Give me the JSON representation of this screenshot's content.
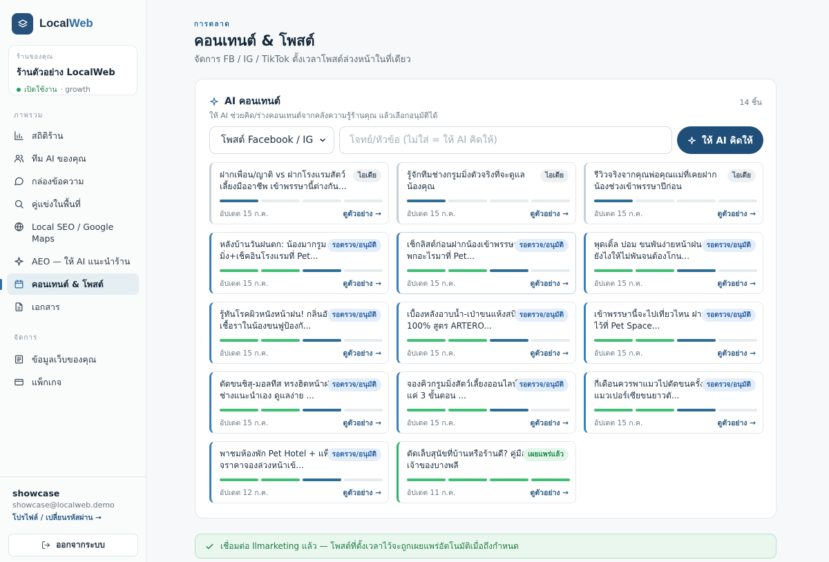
{
  "brand": {
    "name_prefix": "Local",
    "name_suffix": "Web"
  },
  "shop": {
    "kicker": "ร้านของคุณ",
    "name": "ร้านตัวอย่าง LocalWeb",
    "status": "เปิดใช้งาน",
    "plan": "· growth"
  },
  "nav": {
    "section_overview": "ภาพรวม",
    "items": [
      {
        "label": "สถิติร้าน",
        "icon": "chart-icon"
      },
      {
        "label": "ทีม AI ของคุณ",
        "icon": "users-icon"
      },
      {
        "label": "กล่องข้อความ",
        "icon": "message-icon"
      },
      {
        "label": "คู่แข่งในพื้นที่",
        "icon": "search-icon"
      },
      {
        "label": "Local SEO / Google Maps",
        "icon": "globe-icon"
      },
      {
        "label": "AEO — ให้ AI แนะนำร้าน",
        "icon": "sparkle-icon"
      },
      {
        "label": "คอนเทนต์ & โพสต์",
        "icon": "calendar-icon",
        "active": true
      },
      {
        "label": "เอกสาร",
        "icon": "document-icon"
      }
    ],
    "section_manage": "จัดการ",
    "manage_items": [
      {
        "label": "ข้อมูลเว็บของคุณ",
        "icon": "list-icon"
      },
      {
        "label": "แพ็กเกจ",
        "icon": "card-icon"
      }
    ]
  },
  "user": {
    "name": "showcase",
    "email": "showcase@localweb.demo",
    "link": "โปรไฟล์ / เปลี่ยนรหัสผ่าน →",
    "logout": "ออกจากระบบ"
  },
  "page": {
    "kicker": "การตลาด",
    "title": "คอนเทนต์ & โพสต์",
    "subtitle": "จัดการ FB / IG / TikTok ตั้งเวลาโพสต์ล่วงหน้าในที่เดียว"
  },
  "panel": {
    "title": "AI คอนเทนต์",
    "count": "14 ชิ้น",
    "description": "ให้ AI ช่วยคิด/ร่างคอนเทนต์จากคลังความรู้ร้านคุณ แล้วเลือกอนุมัติได้",
    "select_value": "โพสต์ Facebook / IG",
    "input_placeholder": "โจทย์/หัวข้อ (ไม่ใส่ = ให้ AI คิดให้)",
    "ai_button": "ให้ AI คิดให้"
  },
  "cards": [
    {
      "title": "ฝากเพื่อน/ญาติ vs ฝากโรงแรมสัตว์เลี้ยงมืออาชีพ เข้าพรรษานี้ต่างกันแ...",
      "status": "idea",
      "badge": "ไอเดีย",
      "progress": 1,
      "date": "อัปเดต 15 ก.ค.",
      "link": "ดูตัวอย่าง →"
    },
    {
      "title": "รู้จักทีมช่างกรูมมิ่งตัวจริงที่จะดูแลน้องคุณ",
      "status": "idea",
      "badge": "ไอเดีย",
      "progress": 1,
      "date": "อัปเดต 15 ก.ค.",
      "link": "ดูตัวอย่าง →"
    },
    {
      "title": "รีวิวจริงจากคุณพ่อคุณแม่ที่เคยฝากน้องช่วงเข้าพรรษาปีก่อน",
      "status": "idea",
      "badge": "ไอเดีย",
      "progress": 1,
      "date": "อัปเดต 15 ก.ค.",
      "link": "ดูตัวอย่าง →"
    },
    {
      "title": "หลังบ้านวันฝนตก: น้องมากรูมมิ่ง+เช็คอินโรงแรมที่ Pet...",
      "status": "review",
      "badge": "รอตรวจ/อนุมัติ",
      "progress": 3,
      "date": "อัปเดต 15 ก.ค.",
      "link": "ดูตัวอย่าง →"
    },
    {
      "title": "เช็กลิสต์ก่อนฝากน้องเข้าพรรษานี้ พกอะไรมาที่ Pet...",
      "status": "review",
      "badge": "รอตรวจ/อนุมัติ",
      "progress": 3,
      "date": "อัปเดต 15 ก.ค.",
      "link": "ดูตัวอย่าง →",
      "highlight": true
    },
    {
      "title": "พุดเดิ้ล ปอม ขนพันง่ายหน้าฝน ดูแลยังไงให้ไม่พันจนต้องโกน...",
      "status": "review",
      "badge": "รอตรวจ/อนุมัติ",
      "progress": 3,
      "date": "อัปเดต 15 ก.ค.",
      "link": "ดูตัวอย่าง →"
    },
    {
      "title": "รู้ทันโรคผิวหนังหน้าฝน! กลิ่นอับ-เชื้อราในน้องขนฟูป้องกั...",
      "status": "review",
      "badge": "รอตรวจ/อนุมัติ",
      "progress": 3,
      "date": "อัปเดต 15 ก.ค.",
      "link": "ดูตัวอย่าง →"
    },
    {
      "title": "เบื้องหลังอาบน้ำ-เป่าขนแห้งสนิท 100% สูตร ARTERO...",
      "status": "review",
      "badge": "รอตรวจ/อนุมัติ",
      "progress": 3,
      "date": "อัปเดต 15 ก.ค.",
      "link": "ดูตัวอย่าง →"
    },
    {
      "title": "เข้าพรรษานี้จะไปเที่ยวไหน ฝากน้องไว้ที่ Pet Space...",
      "status": "review",
      "badge": "รอตรวจ/อนุมัติ",
      "progress": 3,
      "date": "อัปเดต 15 ก.ค.",
      "link": "ดูตัวอย่าง →"
    },
    {
      "title": "ตัดขนชิสุ-มอลทีส ทรงฮิตหน้าฝน ช่างแนะนำเอง ดูแลง่าย ...",
      "status": "review",
      "badge": "รอตรวจ/อนุมัติ",
      "progress": 3,
      "date": "อัปเดต 15 ก.ค.",
      "link": "ดูตัวอย่าง →"
    },
    {
      "title": "จองคิวกรูมมิ่งสัตว์เลี้ยงออนไลน์ ง่ายแค่ 3 ขั้นตอน ...",
      "status": "review",
      "badge": "รอตรวจ/อนุมัติ",
      "progress": 3,
      "date": "อัปเดต 15 ก.ค.",
      "link": "ดูตัวอย่าง →"
    },
    {
      "title": "กี่เดือนควรพาแมวไปตัดขนครั้ง? แมวเปอร์เซียขนยาวตั...",
      "status": "review",
      "badge": "รอตรวจ/อนุมัติ",
      "progress": 3,
      "date": "อัปเดต 15 ก.ค.",
      "link": "ดูตัวอย่าง →"
    },
    {
      "title": "พาชมห้องพัก Pet Hotel + แพ็กเกจราคาจองล่วงหน้าเข้...",
      "status": "review",
      "badge": "รอตรวจ/อนุมัติ",
      "progress": 3,
      "date": "อัปเดต 12 ก.ค.",
      "link": "ดูตัวอย่าง →"
    },
    {
      "title": "ตัดเล็บสุนัขที่บ้านหรือร้านดี? คู่มือเจ้าของบางพลี",
      "status": "published",
      "badge": "เผยแพร่แล้ว",
      "progress": 4,
      "date": "อัปเดต 11 ก.ค.",
      "link": "ดูตัวอย่าง →"
    }
  ],
  "banner": {
    "text": "เชื่อมต่อ llmarketing แล้ว — โพสต์ที่ตั้งเวลาไว้จะถูกเผยแพร่อัตโนมัติเมื่อถึงกำหนด"
  },
  "colors": {
    "accent": "#2d6ea3",
    "primary_button": "#1f4e78",
    "success": "#2fb36a",
    "review_badge": "#2a63a6"
  }
}
